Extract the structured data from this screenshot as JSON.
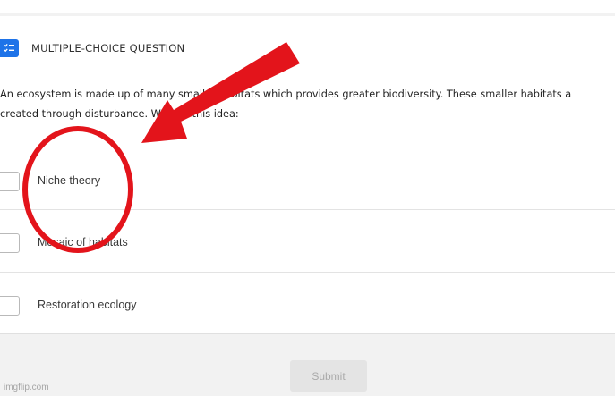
{
  "question": {
    "type_label": "MULTIPLE-CHOICE QUESTION",
    "type_icon": "checklist-icon",
    "line1": "An ecosystem is made up of many smaller habitats which provides greater biodiversity.  These smaller habitats a",
    "line2": "created through disturbance.  What is this idea:"
  },
  "options": [
    {
      "label": "Niche theory",
      "checked": false
    },
    {
      "label": "Mosaic of habitats",
      "checked": false
    },
    {
      "label": "Restoration ecology",
      "checked": false
    }
  ],
  "submit": {
    "label": "Submit",
    "enabled": false
  },
  "watermark": "imgflip.com",
  "colors": {
    "accent": "#1e73e8",
    "annotation_red": "#e3141b"
  }
}
